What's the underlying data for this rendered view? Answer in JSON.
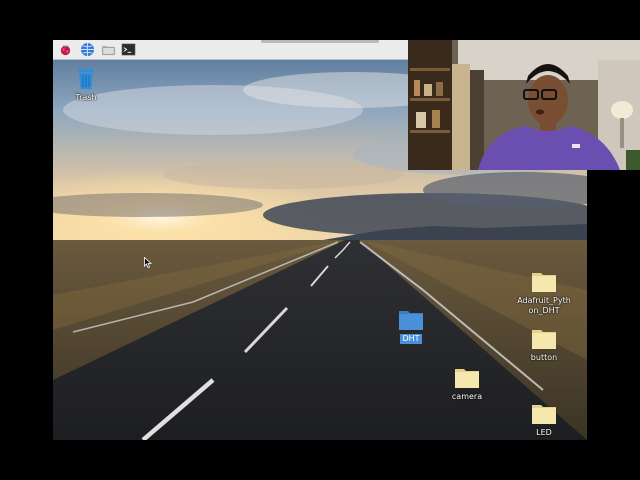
{
  "taskbar": {
    "launchers": [
      {
        "name": "raspberry-menu-icon",
        "tooltip": "Menu"
      },
      {
        "name": "web-browser-icon",
        "tooltip": "Web Browser"
      },
      {
        "name": "file-manager-icon",
        "tooltip": "File Manager"
      },
      {
        "name": "terminal-icon",
        "tooltip": "Terminal"
      }
    ]
  },
  "desktop": {
    "icons": [
      {
        "name": "trash",
        "label": "Trash",
        "icon": "trash-icon"
      },
      {
        "name": "adafruit-python-dht",
        "label": "Adafruit_Python_DHT",
        "icon": "folder-icon"
      },
      {
        "name": "button",
        "label": "button",
        "icon": "folder-icon"
      },
      {
        "name": "dht",
        "label": "DHT",
        "icon": "folder-icon",
        "selected": true
      },
      {
        "name": "camera",
        "label": "camera",
        "icon": "folder-icon"
      },
      {
        "name": "led",
        "label": "LED",
        "icon": "folder-icon"
      }
    ],
    "wallpaper": "road-at-sunset"
  },
  "colors": {
    "panel": "#ececec",
    "folder": "#f6e7ae",
    "selected_folder": "#4a90d9",
    "trash": "#2f8fd8",
    "shirt": "#6a4fb0"
  }
}
